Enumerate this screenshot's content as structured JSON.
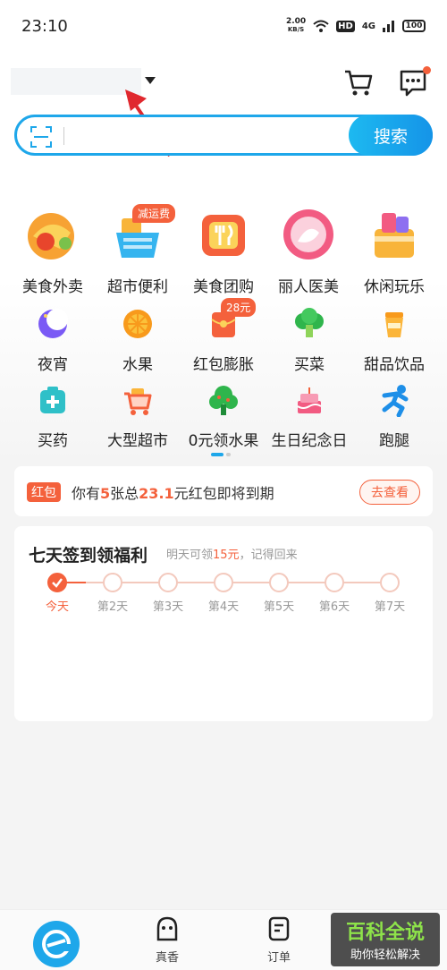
{
  "status_bar": {
    "time": "23:10",
    "speed_value": "2.00",
    "speed_unit": "KB/S",
    "hd": "HD",
    "network": "4G",
    "battery": "100"
  },
  "search": {
    "button_label": "搜索"
  },
  "categories_big": [
    {
      "label": "美食外卖",
      "icon": "food-delivery-icon"
    },
    {
      "label": "超市便利",
      "icon": "supermarket-basket-icon",
      "badge": "减运费"
    },
    {
      "label": "美食团购",
      "icon": "group-buy-icon"
    },
    {
      "label": "丽人医美",
      "icon": "beauty-icon"
    },
    {
      "label": "休闲玩乐",
      "icon": "leisure-icon"
    }
  ],
  "categories_row2": [
    {
      "label": "夜宵",
      "icon": "moon-icon"
    },
    {
      "label": "水果",
      "icon": "orange-icon"
    },
    {
      "label": "红包膨胀",
      "icon": "red-packet-icon",
      "badge": "28元"
    },
    {
      "label": "买菜",
      "icon": "vegetable-icon"
    },
    {
      "label": "甜品饮品",
      "icon": "drink-icon"
    }
  ],
  "categories_row3": [
    {
      "label": "买药",
      "icon": "medicine-icon"
    },
    {
      "label": "大型超市",
      "icon": "shopping-cart-icon"
    },
    {
      "label": "0元领水果",
      "icon": "tree-icon"
    },
    {
      "label": "生日纪念日",
      "icon": "cake-icon"
    },
    {
      "label": "跑腿",
      "icon": "runner-icon"
    }
  ],
  "coupon": {
    "tag": "红包",
    "text_1": "你有",
    "count": "5",
    "text_2": "张总",
    "amount": "23.1",
    "text_3": "元红包即将到期",
    "button": "去查看"
  },
  "checkin": {
    "title": "七天签到领福利",
    "sub_1": "明天可领",
    "sub_amount": "15元",
    "sub_2": "，记得回来",
    "days": [
      "今天",
      "第2天",
      "第3天",
      "第4天",
      "第5天",
      "第6天",
      "第7天"
    ],
    "completed_days": 1
  },
  "nav": {
    "items": [
      {
        "label": "真香"
      },
      {
        "label": "订单"
      }
    ]
  },
  "watermark": {
    "title": "百科全说",
    "subtitle": "助你轻松解决"
  },
  "colors": {
    "accent": "#1ea7ea",
    "highlight": "#f4613c"
  }
}
